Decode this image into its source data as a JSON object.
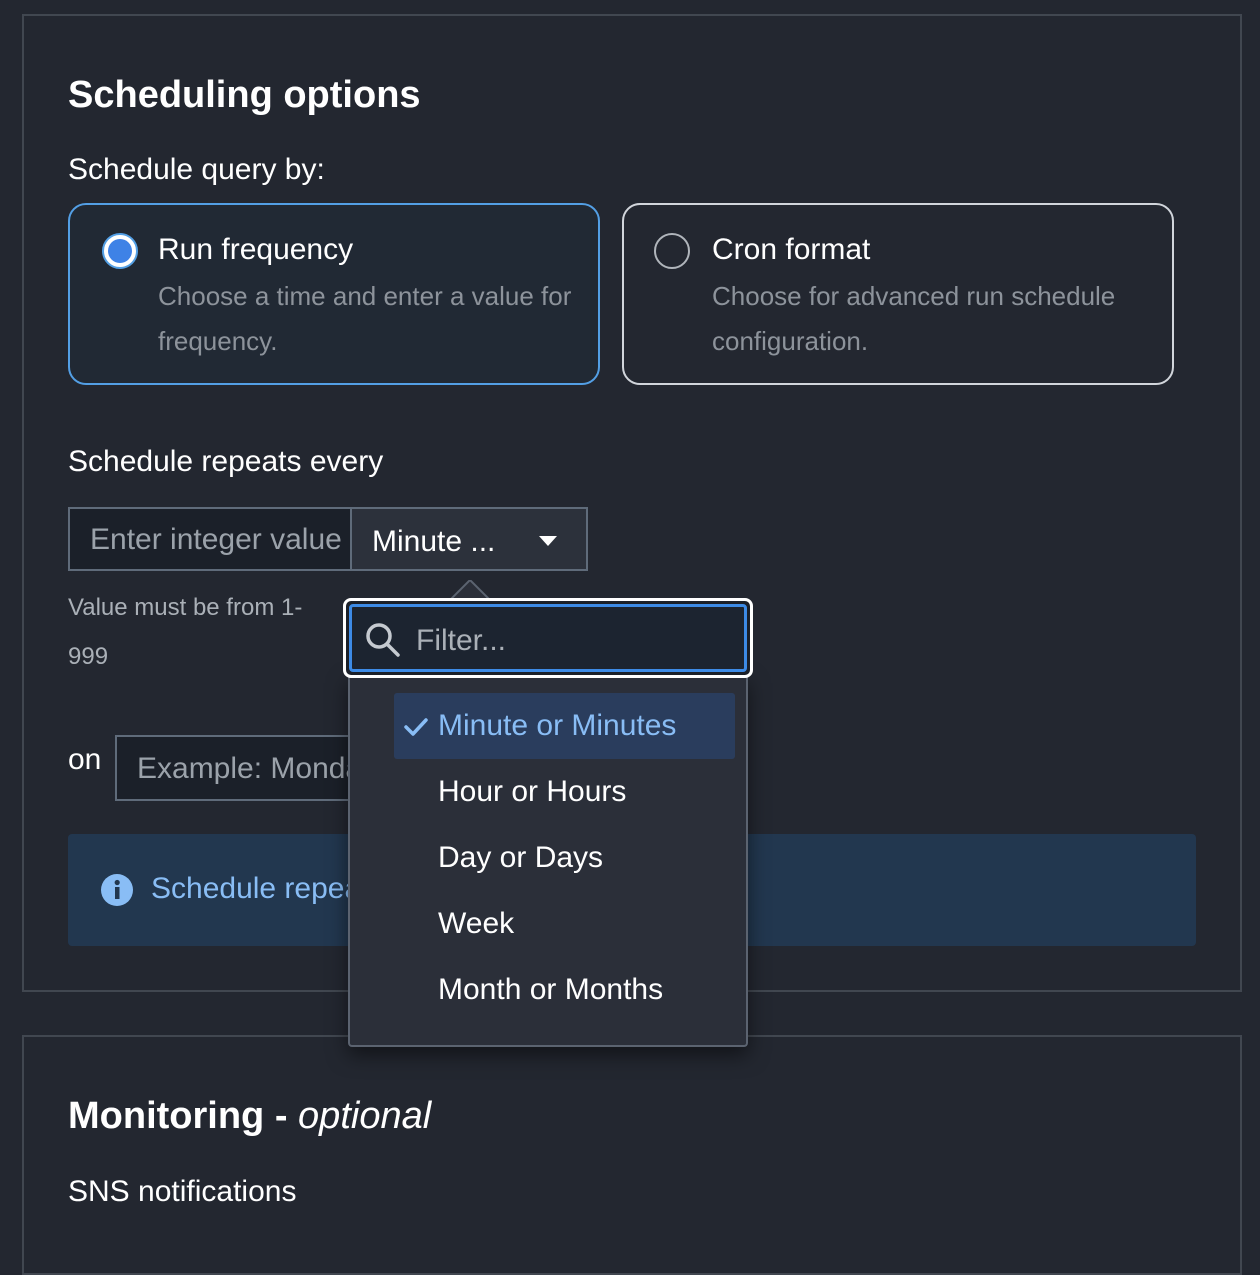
{
  "scheduling": {
    "title": "Scheduling options",
    "schedule_by_label": "Schedule query by:",
    "options": [
      {
        "title": "Run frequency",
        "description": "Choose a time and enter a value for frequency.",
        "selected": true
      },
      {
        "title": "Cron format",
        "description": "Choose for advanced run schedule configuration.",
        "selected": false
      }
    ],
    "repeats_label": "Schedule repeats every",
    "value_input": {
      "placeholder": "Enter integer value",
      "value": ""
    },
    "unit_select": {
      "value": "Minute ..."
    },
    "hint": "Value must be from 1-999",
    "on_label": "on",
    "day_input": {
      "placeholder": "Example: Monday",
      "value": ""
    },
    "info_text": "Schedule repeats",
    "dropdown": {
      "filter_placeholder": "Filter...",
      "items": [
        "Minute or Minutes",
        "Hour or Hours",
        "Day or Days",
        "Week",
        "Month or Months"
      ],
      "selected_index": 0
    }
  },
  "monitoring": {
    "title_main": "Monitoring - ",
    "title_optional": "optional",
    "sns_label": "SNS notifications"
  },
  "colors": {
    "background": "#232730",
    "accent": "#539fe5",
    "selected_item_bg": "#2a3d5d",
    "info_bg": "#22374f"
  }
}
